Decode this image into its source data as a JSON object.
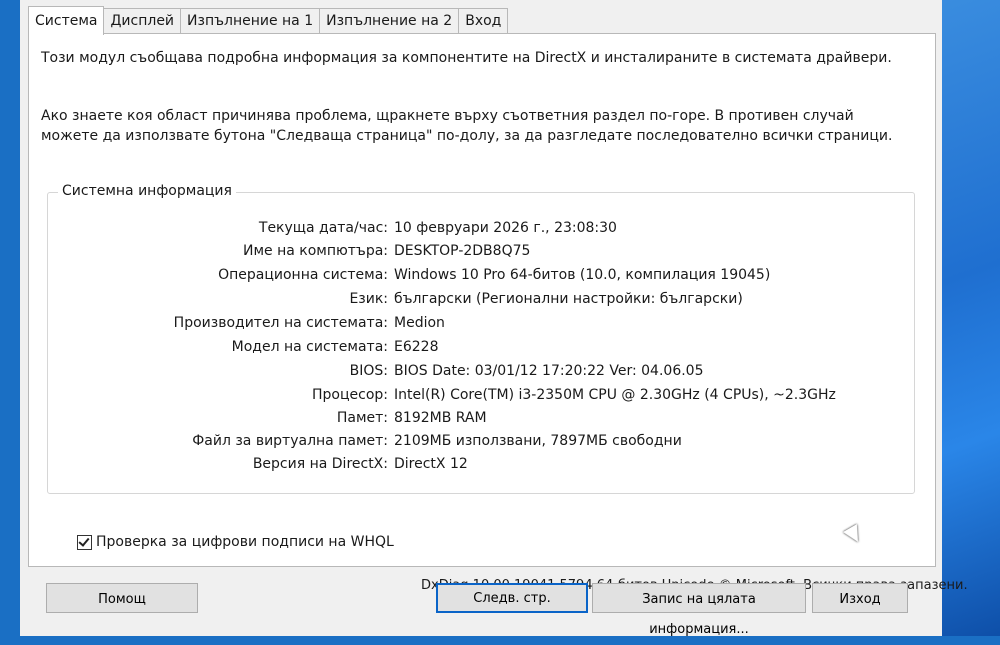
{
  "tabs": [
    "Система",
    "Дисплей",
    "Изпълнение на 1",
    "Изпълнение на 2",
    "Вход"
  ],
  "intro": {
    "line1": "Този модул съобщава подробна информация за компонентите на DirectX и инсталираните в системата драйвери.",
    "line2": "Ако знаете коя област причинява проблема, щракнете върху съответния раздел по-горе. В противен случай можете да използвате бутона \"Следваща страница\" по-долу, за да разгледате последователно всички страници."
  },
  "system_info": {
    "title": "Системна информация",
    "rows": [
      {
        "label": "Текуща дата/час:",
        "value": "10 февруари 2026 г., 23:08:30"
      },
      {
        "label": "Име на компютъра:",
        "value": "DESKTOP-2DB8Q75"
      },
      {
        "label": "Операционна система:",
        "value": "Windows 10 Pro 64-битов (10.0, компилация 19045)"
      },
      {
        "label": "Език:",
        "value": "български (Регионални настройки: български)"
      },
      {
        "label": "Производител на системата:",
        "value": "Medion"
      },
      {
        "label": "Модел на системата:",
        "value": "E6228"
      },
      {
        "label": "BIOS:",
        "value": "BIOS Date: 03/01/12 17:20:22 Ver: 04.06.05"
      },
      {
        "label": "Процесор:",
        "value": "Intel(R) Core(TM) i3-2350M CPU @ 2.30GHz (4 CPUs), ~2.3GHz"
      },
      {
        "label": "Памет:",
        "value": "8192MB RAM"
      },
      {
        "label": "Файл за виртуална памет:",
        "value": "2109МБ използвани, 7897МБ свободни"
      },
      {
        "label": "Версия на DirectX:",
        "value": "DirectX 12"
      }
    ]
  },
  "whql_label": "Проверка за цифрови подписи на WHQL",
  "whql_checked": true,
  "copyright": "DxDiag 10.00.19041.5794 64-битов Unicode © Microsoft. Всички права запазени.",
  "buttons": {
    "help": "Помощ",
    "next": "Следв. стр.",
    "save": "Запис на цялата информация...",
    "exit": "Изход"
  }
}
